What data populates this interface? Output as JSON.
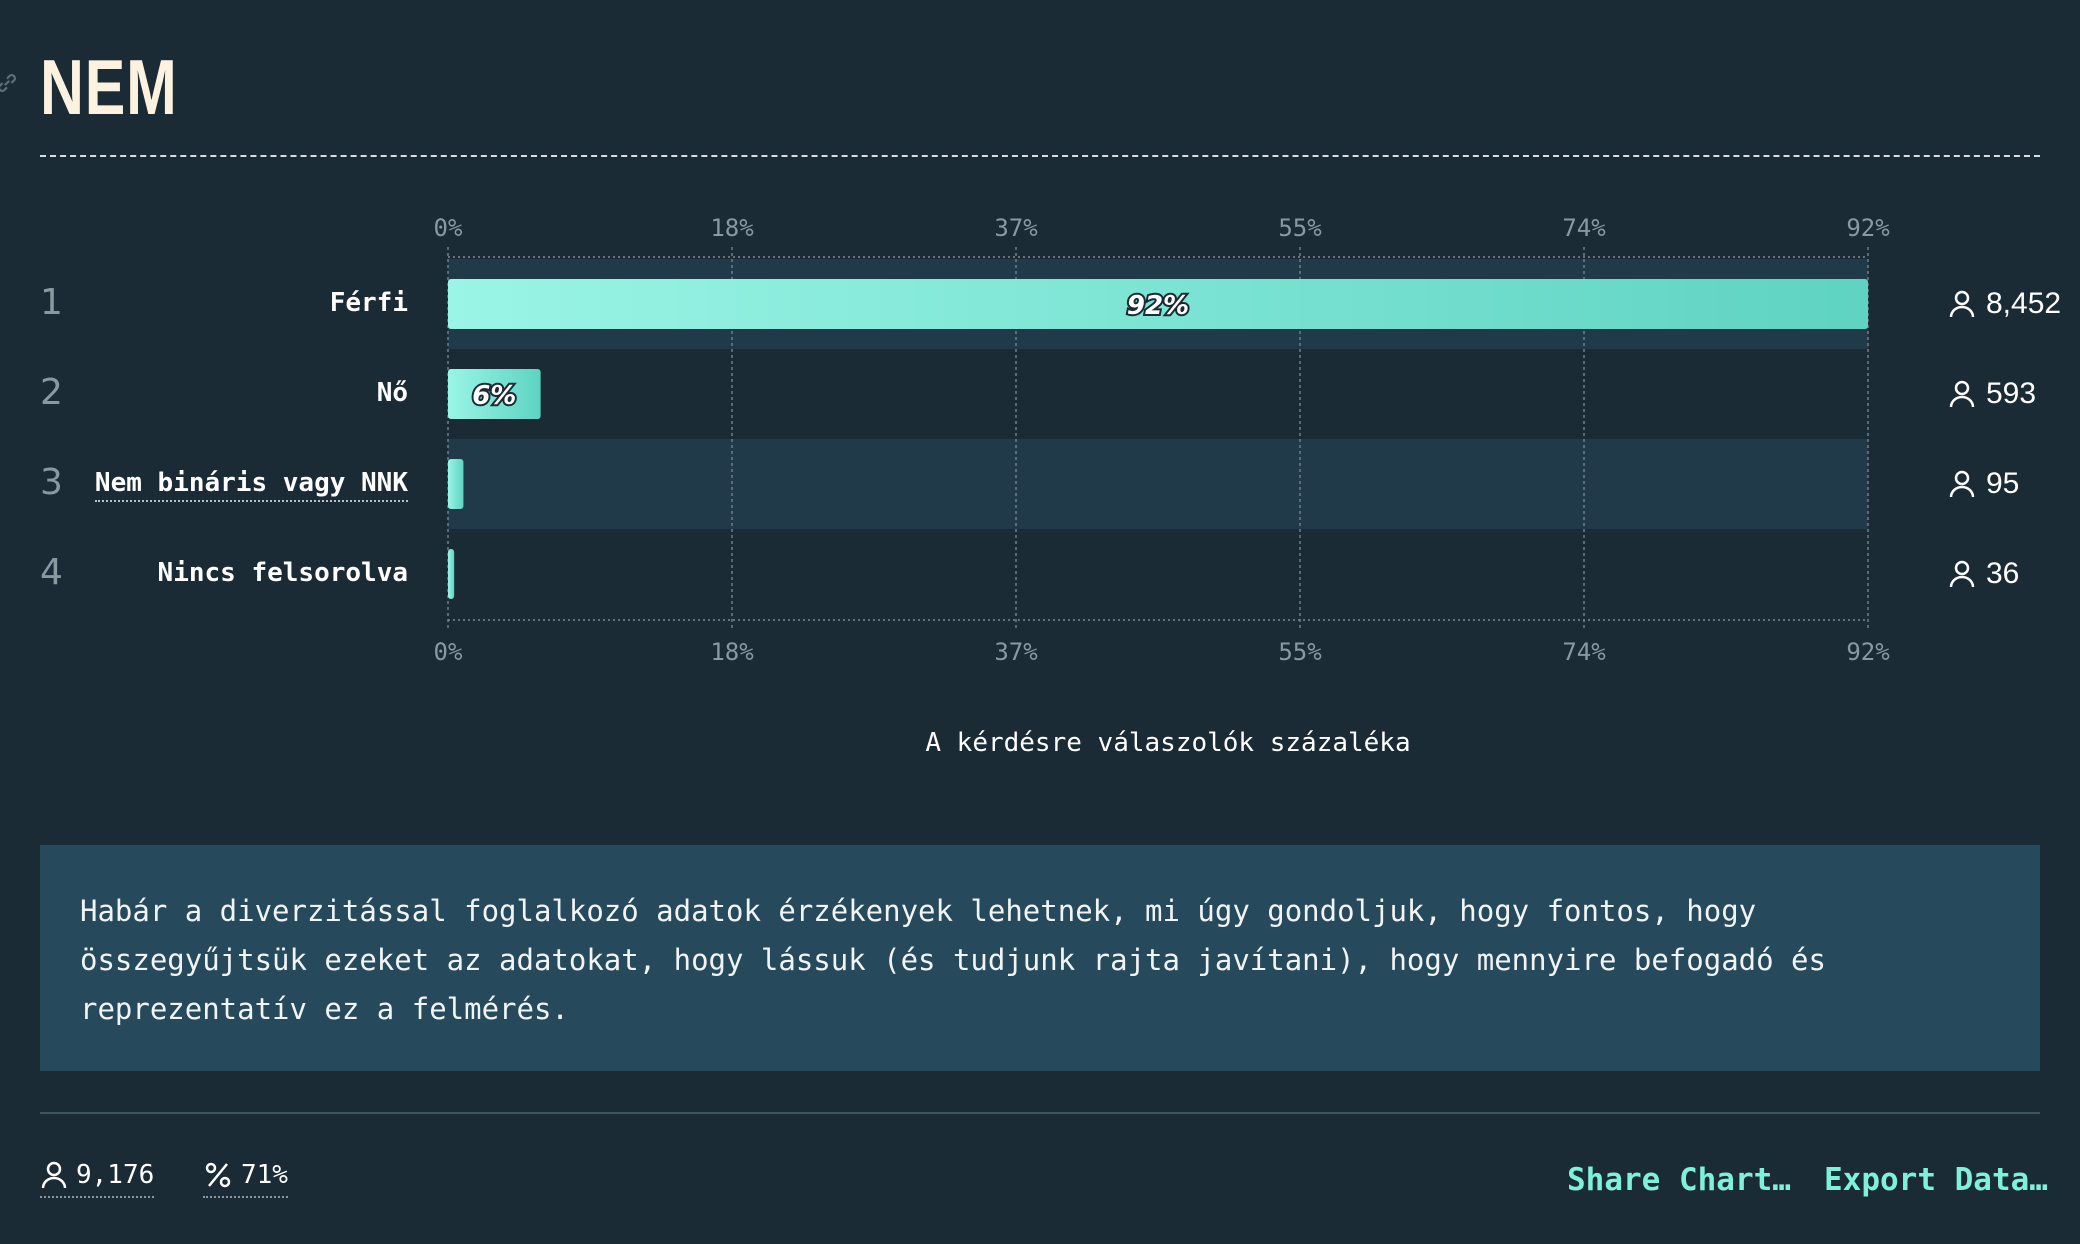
{
  "page": {
    "title": "NEM"
  },
  "chart_data": {
    "type": "bar",
    "orientation": "horizontal",
    "categories": [
      "Férfi",
      "Nő",
      "Nem bináris vagy NNK",
      "Nincs felsorolva"
    ],
    "ranks": [
      "1",
      "2",
      "3",
      "4"
    ],
    "values": [
      92,
      6,
      1,
      0.4
    ],
    "value_labels": [
      "92%",
      "6%",
      "",
      ""
    ],
    "counts": [
      "8,452",
      "593",
      "95",
      "36"
    ],
    "x_ticks": [
      "0%",
      "18%",
      "37%",
      "55%",
      "74%",
      "92%"
    ],
    "xlim": [
      0,
      92
    ],
    "xlabel": "A kérdésre válaszolók százaléka",
    "grid": true
  },
  "note": {
    "text": "Habár a diverzitással foglalkozó adatok érzékenyek lehetnek, mi úgy gondoljuk, hogy fontos, hogy összegyűjtsük ezeket az adatokat, hogy lássuk (és tudjunk rajta javítani), hogy mennyire befogadó és reprezentatív ez a felmérés."
  },
  "footer": {
    "respondents": "9,176",
    "percentage": "71%",
    "share_label": "Share Chart…",
    "export_label": "Export Data…"
  },
  "colors": {
    "accent": "#7ff0dc",
    "bar_start": "#9af5e6",
    "bar_end": "#5fd3c2",
    "background": "#1a2b36",
    "note_bg": "#264a5c"
  },
  "icons": {
    "link": "link-icon",
    "user": "user-icon",
    "percent": "percent-icon"
  }
}
